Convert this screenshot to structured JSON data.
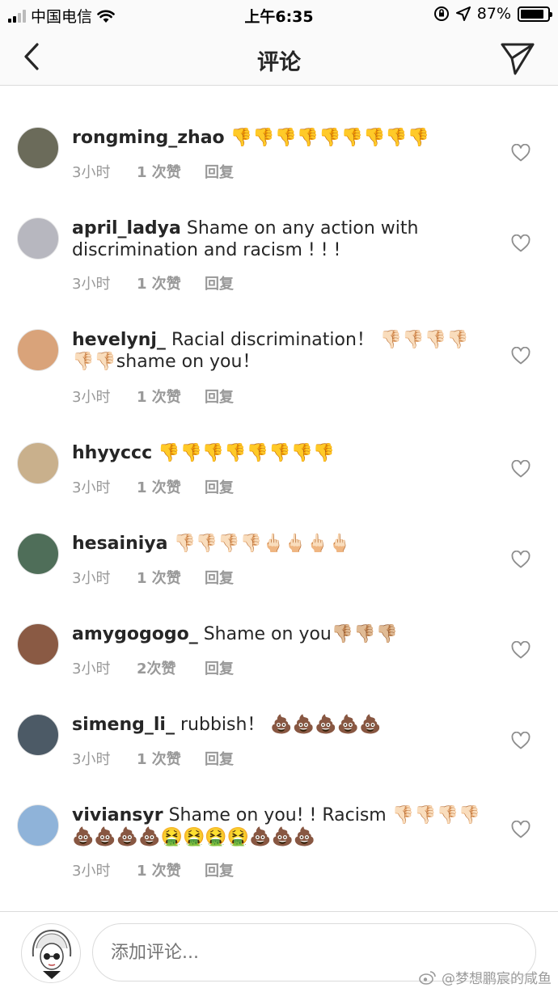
{
  "status_bar": {
    "carrier": "中国电信",
    "time": "上午6:35",
    "battery": "87%",
    "battery_level": 0.87
  },
  "header": {
    "title": "评论"
  },
  "comments": [
    {
      "username": "rongming_zhao",
      "text": "👎👎👎👎👎👎👎👎👎",
      "time": "3小时",
      "likes": "1 次赞",
      "reply": "回复",
      "avatar_color": "#6b6b5a"
    },
    {
      "username": "april_ladya",
      "text": "Shame on any action with discrimination and racism ! ! !",
      "time": "3小时",
      "likes": "1 次赞",
      "reply": "回复",
      "avatar_color": "#b7b7bf"
    },
    {
      "username": "hevelynj_",
      "text": "Racial discrimination！ 👎🏻👎🏻👎🏻👎🏻👎🏻👎🏻shame on you！",
      "time": "3小时",
      "likes": "1 次赞",
      "reply": "回复",
      "avatar_color": "#d9a37a"
    },
    {
      "username": "hhyyccc",
      "text": "👎👎👎👎👎👎👎👎",
      "time": "3小时",
      "likes": "1 次赞",
      "reply": "回复",
      "avatar_color": "#c9b08c"
    },
    {
      "username": "hesainiya",
      "text": "👎🏻👎🏻👎🏻👎🏻🖕🏻🖕🏻🖕🏻🖕🏻",
      "time": "3小时",
      "likes": "1 次赞",
      "reply": "回复",
      "avatar_color": "#4f6e59"
    },
    {
      "username": "amygogogo_",
      "text": "Shame on you👎🏼👎🏼👎🏼",
      "time": "3小时",
      "likes": "2次赞",
      "reply": "回复",
      "avatar_color": "#8a5a44"
    },
    {
      "username": "simeng_li_",
      "text": "rubbish！ 💩💩💩💩💩",
      "time": "3小时",
      "likes": "1 次赞",
      "reply": "回复",
      "avatar_color": "#4c5a66"
    },
    {
      "username": "viviansyr",
      "text": "Shame on you! ! Racism 👎🏻👎🏻👎🏻👎🏻💩💩💩💩🤮🤮🤮🤮💩💩💩",
      "time": "3小时",
      "likes": "1 次赞",
      "reply": "回复",
      "avatar_color": "#8fb3d9"
    }
  ],
  "composer": {
    "placeholder": "添加评论..."
  },
  "watermark": {
    "text": "@梦想鹏宸的咸鱼"
  }
}
